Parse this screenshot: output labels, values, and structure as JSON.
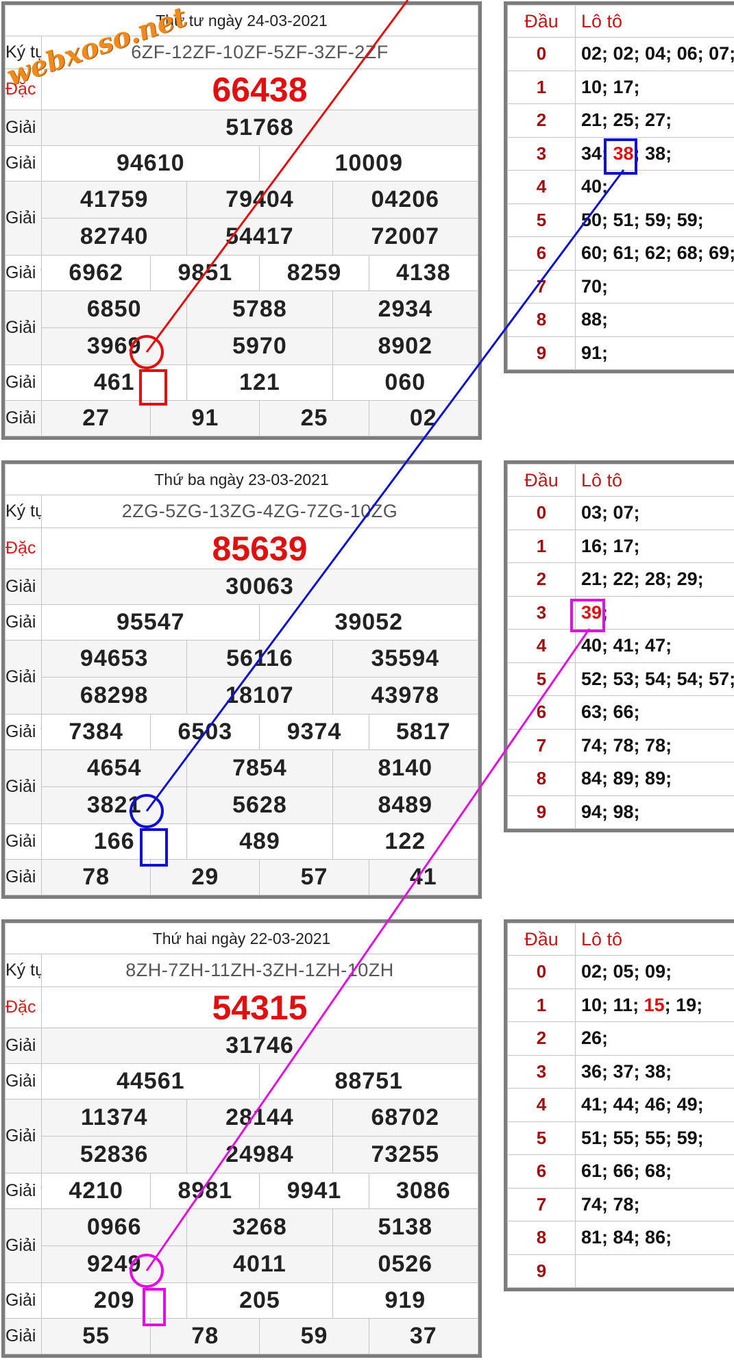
{
  "watermark": "webxoso.net",
  "results": [
    {
      "date": "Thứ tư ngày 24-03-2021",
      "kytu": "6ZF-12ZF-10ZF-5ZF-3ZF-2ZF",
      "db": "66438",
      "nhat": "51768",
      "nhi": [
        "94610",
        "10009"
      ],
      "ba": [
        "41759",
        "79404",
        "04206",
        "82740",
        "54417",
        "72007"
      ],
      "tu": [
        "6962",
        "9851",
        "8259",
        "4138"
      ],
      "nam": [
        "6850",
        "5788",
        "2934",
        "3969",
        "5970",
        "8902"
      ],
      "sau": [
        "461",
        "121",
        "060"
      ],
      "bay": [
        "27",
        "91",
        "25",
        "02"
      ]
    },
    {
      "date": "Thứ ba ngày 23-03-2021",
      "kytu": "2ZG-5ZG-13ZG-4ZG-7ZG-10ZG",
      "db": "85639",
      "nhat": "30063",
      "nhi": [
        "95547",
        "39052"
      ],
      "ba": [
        "94653",
        "56116",
        "35594",
        "68298",
        "18107",
        "43978"
      ],
      "tu": [
        "7384",
        "6503",
        "9374",
        "5817"
      ],
      "nam": [
        "4654",
        "7854",
        "8140",
        "3821",
        "5628",
        "8489"
      ],
      "sau": [
        "166",
        "489",
        "122"
      ],
      "bay": [
        "78",
        "29",
        "57",
        "41"
      ]
    },
    {
      "date": "Thứ hai ngày 22-03-2021",
      "kytu": "8ZH-7ZH-11ZH-3ZH-1ZH-10ZH",
      "db": "54315",
      "nhat": "31746",
      "nhi": [
        "44561",
        "88751"
      ],
      "ba": [
        "11374",
        "28144",
        "68702",
        "52836",
        "24984",
        "73255"
      ],
      "tu": [
        "4210",
        "8981",
        "9941",
        "3086"
      ],
      "nam": [
        "0966",
        "3268",
        "5138",
        "9249",
        "4011",
        "0526"
      ],
      "sau": [
        "209",
        "205",
        "919"
      ],
      "bay": [
        "55",
        "78",
        "59",
        "37"
      ]
    }
  ],
  "labels": {
    "kytu": "Ký tự",
    "db": "Đặc biệt",
    "nhat": "Giải nhất",
    "nhi": "Giải nhì",
    "ba": "Giải ba",
    "tu": "Giải tư",
    "nam": "Giải năm",
    "sau": "Giải sáu",
    "bay": "Giải bảy"
  },
  "loto_headers": {
    "dau": "Đầu",
    "loto": "Lô tô"
  },
  "loto": [
    {
      "rows": [
        {
          "dau": "0",
          "parts": [
            "02; 02; 04; 06; 07;"
          ]
        },
        {
          "dau": "1",
          "parts": [
            "10; 17;"
          ]
        },
        {
          "dau": "2",
          "parts": [
            "21; 25; 27;"
          ]
        },
        {
          "dau": "3",
          "parts": [
            "34; ",
            "38",
            "; 38;"
          ],
          "hl": 1
        },
        {
          "dau": "4",
          "parts": [
            "40;"
          ]
        },
        {
          "dau": "5",
          "parts": [
            "50; 51; 59; 59;"
          ]
        },
        {
          "dau": "6",
          "parts": [
            "60; 61; 62; 68; 69;"
          ]
        },
        {
          "dau": "7",
          "parts": [
            "70;"
          ]
        },
        {
          "dau": "8",
          "parts": [
            "88;"
          ]
        },
        {
          "dau": "9",
          "parts": [
            "91;"
          ]
        }
      ]
    },
    {
      "rows": [
        {
          "dau": "0",
          "parts": [
            "03; 07;"
          ]
        },
        {
          "dau": "1",
          "parts": [
            "16; 17;"
          ]
        },
        {
          "dau": "2",
          "parts": [
            "21; 22; 28; 29;"
          ]
        },
        {
          "dau": "3",
          "parts": [
            "",
            "39",
            ";"
          ],
          "hl": 1
        },
        {
          "dau": "4",
          "parts": [
            "40; 41; 47;"
          ]
        },
        {
          "dau": "5",
          "parts": [
            "52; 53; 54; 54; 57;"
          ]
        },
        {
          "dau": "6",
          "parts": [
            "63; 66;"
          ]
        },
        {
          "dau": "7",
          "parts": [
            "74; 78; 78;"
          ]
        },
        {
          "dau": "8",
          "parts": [
            "84; 89; 89;"
          ]
        },
        {
          "dau": "9",
          "parts": [
            "94; 98;"
          ]
        }
      ]
    },
    {
      "rows": [
        {
          "dau": "0",
          "parts": [
            "02; 05; 09;"
          ]
        },
        {
          "dau": "1",
          "parts": [
            "10; 11; ",
            "15",
            "; 19;"
          ],
          "hl": 1
        },
        {
          "dau": "2",
          "parts": [
            "26;"
          ]
        },
        {
          "dau": "3",
          "parts": [
            "36; 37; 38;"
          ]
        },
        {
          "dau": "4",
          "parts": [
            "41; 44; 46; 49;"
          ]
        },
        {
          "dau": "5",
          "parts": [
            "51; 55; 55; 59;"
          ]
        },
        {
          "dau": "6",
          "parts": [
            "61; 66; 68;"
          ]
        },
        {
          "dau": "7",
          "parts": [
            "74; 78;"
          ]
        },
        {
          "dau": "8",
          "parts": [
            "81; 84; 86;"
          ]
        },
        {
          "dau": "9",
          "parts": [
            ""
          ]
        }
      ]
    }
  ],
  "colors": {
    "link_red": "#e01010",
    "link_blue": "#1010d0",
    "link_magenta": "#e010e0",
    "special": "#e01010",
    "frame": "#7d7d7d"
  }
}
